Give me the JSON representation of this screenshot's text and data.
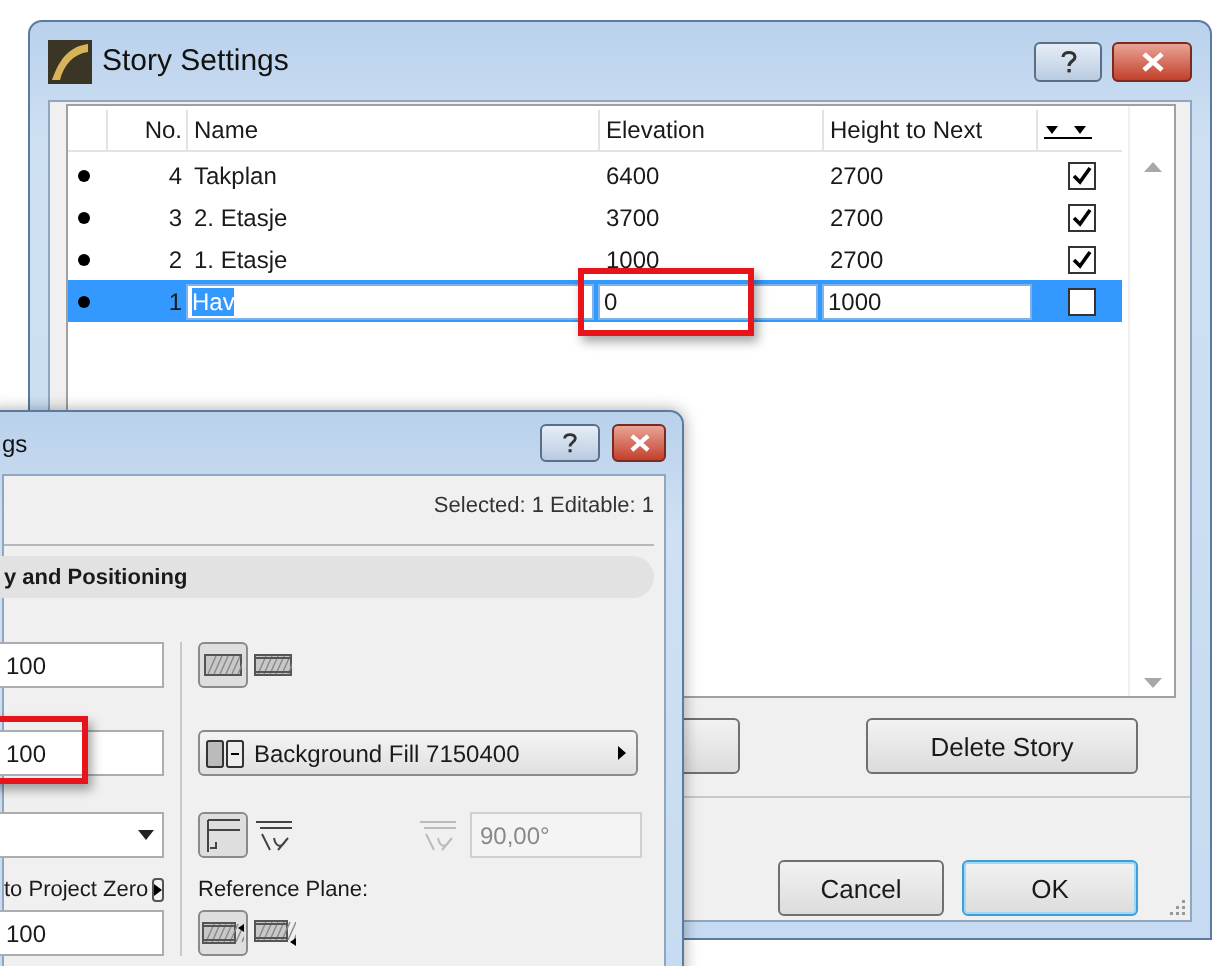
{
  "story_settings": {
    "title": "Story Settings",
    "columns": [
      "No.",
      "Name",
      "Elevation",
      "Height to Next"
    ],
    "rows": [
      {
        "no": "4",
        "name": "Takplan",
        "elevation": "6400",
        "height_to_next": "2700",
        "shown": true,
        "selected": false,
        "elevation_highlighted": false
      },
      {
        "no": "3",
        "name": "2. Etasje",
        "elevation": "3700",
        "height_to_next": "2700",
        "shown": true,
        "selected": false,
        "elevation_highlighted": false
      },
      {
        "no": "2",
        "name": "1. Etasje",
        "elevation": "1000",
        "height_to_next": "2700",
        "shown": true,
        "selected": false,
        "elevation_highlighted": false
      },
      {
        "no": "1",
        "name": "Hav",
        "elevation": "0",
        "height_to_next": "1000",
        "shown": false,
        "selected": true,
        "elevation_highlighted": true
      }
    ],
    "delete_button": "Delete Story",
    "dialog_buttons": [
      {
        "label": "Cancel",
        "default": false
      },
      {
        "label": "OK",
        "default": true
      }
    ]
  },
  "settings_dialog": {
    "title": "gs",
    "selection_info": "Selected: 1 Editable: 1",
    "section_title": "y and Positioning",
    "top_field": {
      "value": "100",
      "highlighted": false
    },
    "second_field": {
      "value": "100",
      "highlighted": true
    },
    "zero_label": "to Project Zero",
    "bottom_field": {
      "value": "100",
      "highlighted": false
    },
    "fill_dropdown": "Background Fill 7150400",
    "angle_field": {
      "value": "90,00°",
      "disabled": true
    },
    "reference_label": "Reference Plane:"
  }
}
